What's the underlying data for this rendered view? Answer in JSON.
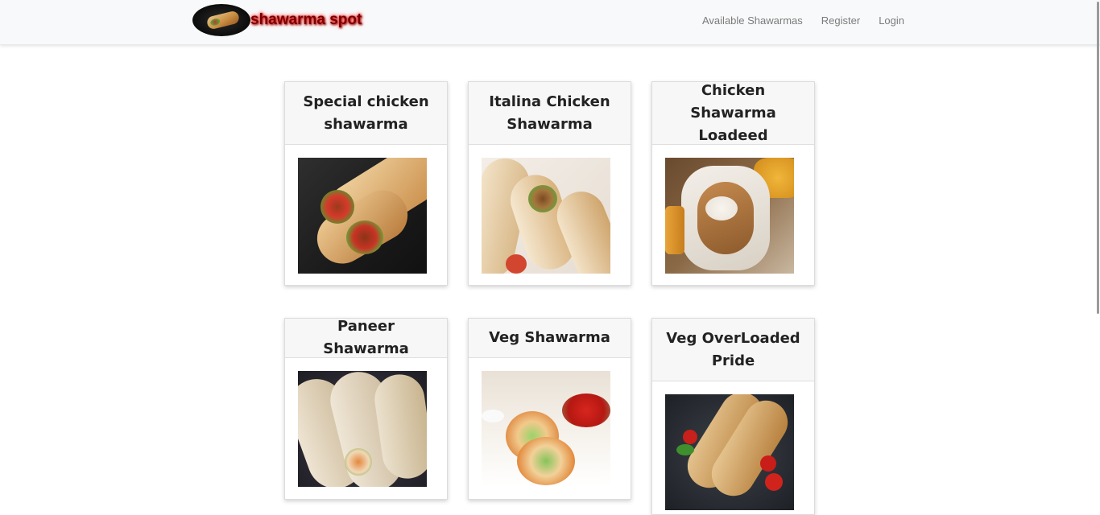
{
  "navbar": {
    "brand": "shawarma spot",
    "links": [
      {
        "label": "Available Shawarmas"
      },
      {
        "label": "Register"
      },
      {
        "label": "Login"
      }
    ]
  },
  "cards": [
    {
      "title": "Special chicken shawarma"
    },
    {
      "title": "Italina Chicken Shawarma"
    },
    {
      "title": "Chicken Shawarma Loadeed"
    },
    {
      "title": "Paneer Shawarma"
    },
    {
      "title": "Veg Shawarma"
    },
    {
      "title": "Veg OverLoaded Pride"
    }
  ],
  "colors": {
    "navbar_bg": "#f8f9fa",
    "brand_text": "#7a0000",
    "brand_glow": "#ff3030",
    "nav_link": "#7b7b7b",
    "card_header_bg": "#f7f7f7"
  }
}
